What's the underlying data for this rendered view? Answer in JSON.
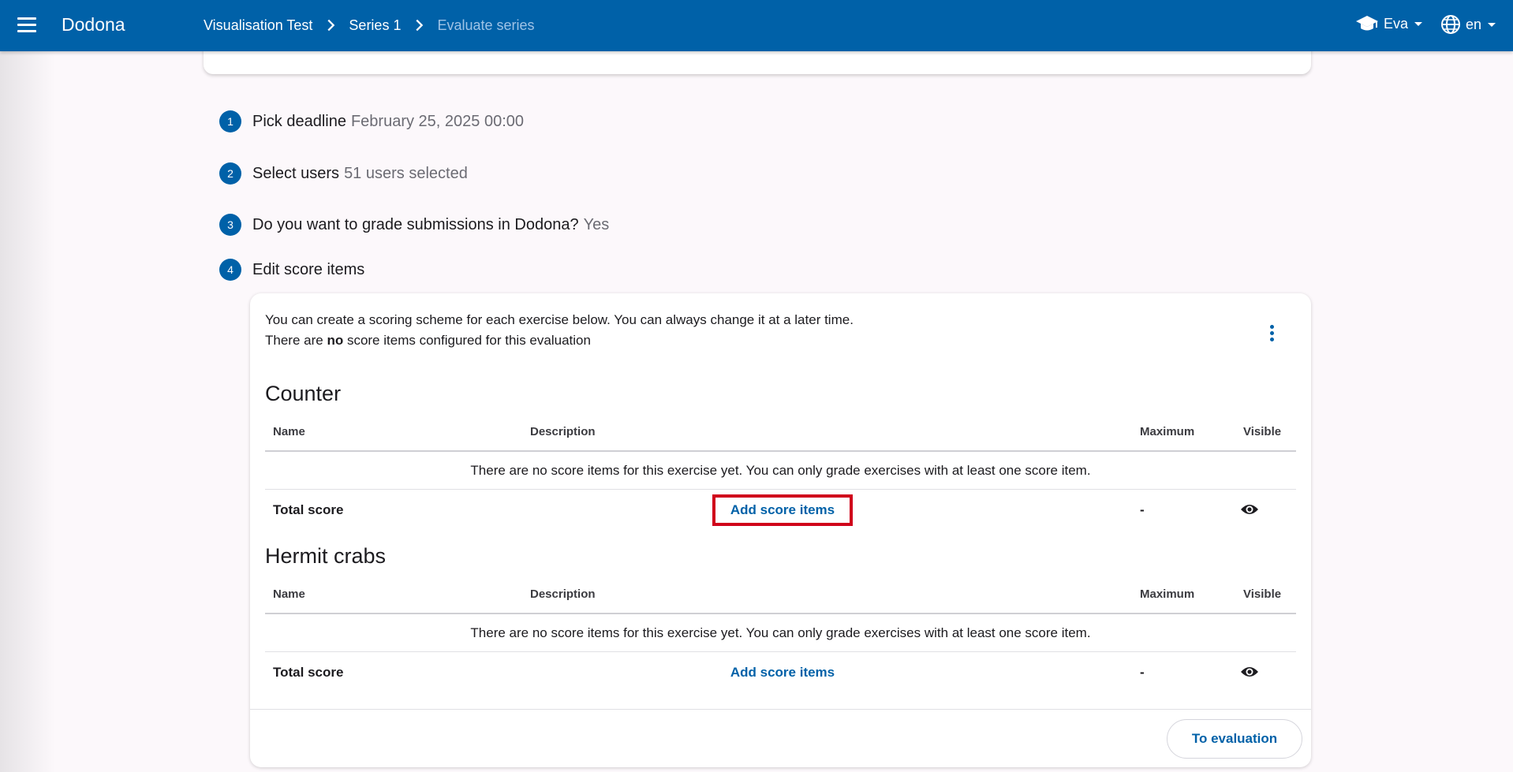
{
  "header": {
    "app_title": "Dodona",
    "menu_icon": "hamburger-menu-icon",
    "breadcrumb": [
      "Visualisation Test",
      "Series 1",
      "Evaluate series"
    ],
    "user_name": "Eva",
    "language": "en",
    "brand_color": "#0061a8"
  },
  "steps": [
    {
      "num": "1",
      "label": "Pick deadline",
      "value": "February 25, 2025 00:00"
    },
    {
      "num": "2",
      "label": "Select users",
      "value": "51 users selected"
    },
    {
      "num": "3",
      "label": "Do you want to grade submissions in Dodona?",
      "value": "Yes"
    },
    {
      "num": "4",
      "label": "Edit score items",
      "value": ""
    }
  ],
  "card": {
    "intro_line1": "You can create a scoring scheme for each exercise below. You can always change it at a later time.",
    "intro_line2_pre": "There are ",
    "intro_line2_bold": "no",
    "intro_line2_post": " score items configured for this evaluation",
    "columns": {
      "name": "Name",
      "description": "Description",
      "maximum": "Maximum",
      "visible": "Visible"
    },
    "exercises": [
      {
        "title": "Counter",
        "empty_message": "There are no score items for this exercise yet. You can only grade exercises with at least one score item.",
        "total_label": "Total score",
        "add_label": "Add score items",
        "maximum": "-",
        "highlighted": true
      },
      {
        "title": "Hermit crabs",
        "empty_message": "There are no score items for this exercise yet. You can only grade exercises with at least one score item.",
        "total_label": "Total score",
        "add_label": "Add score items",
        "maximum": "-",
        "highlighted": false
      }
    ],
    "to_evaluation_label": "To evaluation"
  }
}
